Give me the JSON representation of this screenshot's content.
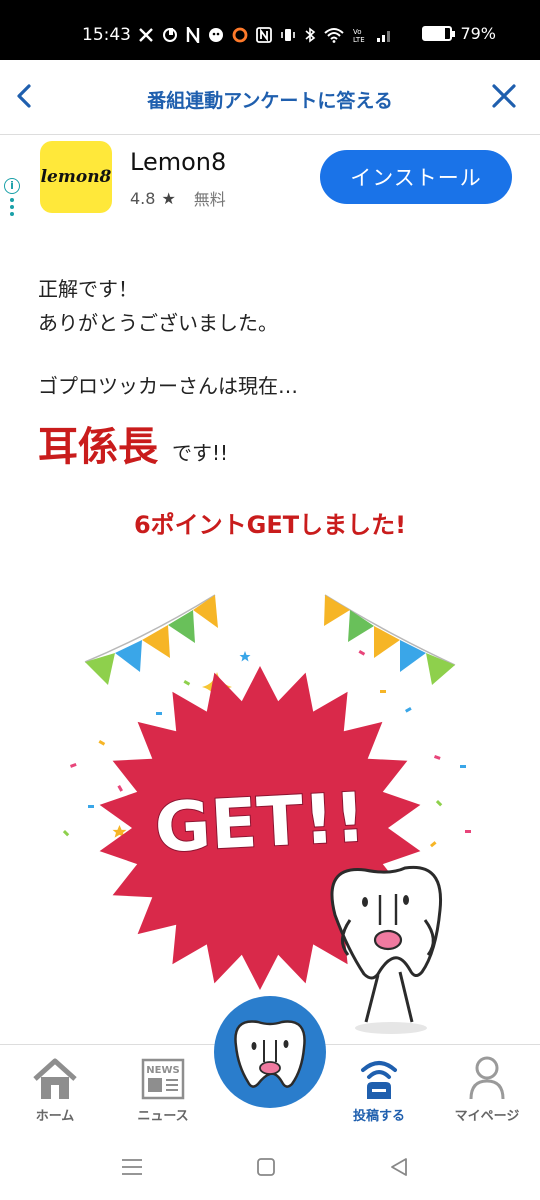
{
  "status_bar": {
    "time": "15:43",
    "battery": "79%",
    "battery_level": 0.79
  },
  "header": {
    "title": "番組連動アンケートに答える"
  },
  "ad": {
    "logo_text": "lemon8",
    "app_name": "Lemon8",
    "rating": "4.8",
    "star": "★",
    "price": "無料",
    "install_label": "インストール",
    "info_glyph": "i"
  },
  "message": {
    "line1": "正解です！",
    "line2": "ありがとうございました。",
    "line3": "ゴプロツッカーさんは現在…",
    "rank": "耳係長",
    "rank_suffix": "です!!",
    "points": "6ポイントGETしました!"
  },
  "illustration": {
    "get_text": "GET!!",
    "burst_color": "#d9294a"
  },
  "bottom_nav": {
    "items": [
      {
        "label": "ホーム",
        "icon": "home-icon"
      },
      {
        "label": "ニュース",
        "icon": "news-icon"
      },
      {
        "label": "投稿する",
        "icon": "broadcast-icon"
      },
      {
        "label": "マイページ",
        "icon": "person-icon"
      }
    ],
    "news_icon_text": "NEWS"
  },
  "colors": {
    "accent": "#1f5fae",
    "red": "#c91c1c",
    "install_blue": "#1a73e8",
    "center_button": "#2a7dcc"
  }
}
